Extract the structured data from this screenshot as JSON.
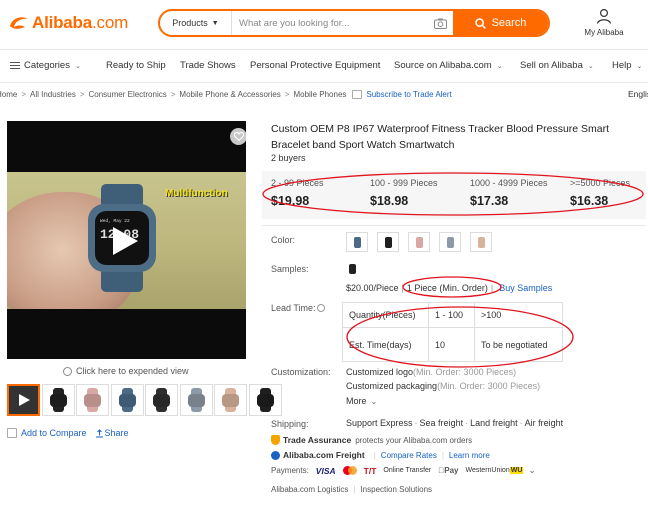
{
  "header": {
    "logo_text": "Alibaba",
    "logo_suffix": ".com",
    "search_category": "Products",
    "search_placeholder": "What are you looking for...",
    "search_button": "Search",
    "account_label": "My Alibaba",
    "accent_color": "#ff6a00"
  },
  "nav": {
    "categories": "Categories",
    "ready_to_ship": "Ready to Ship",
    "trade_shows": "Trade Shows",
    "ppe": "Personal Protective Equipment",
    "source": "Source on Alibaba.com",
    "sell": "Sell on Alibaba",
    "help": "Help"
  },
  "breadcrumb": {
    "items": [
      "Home",
      "All Industries",
      "Consumer Electronics",
      "Mobile Phone & Accessories",
      "Mobile Phones"
    ],
    "alert_link": "Subscribe to Trade Alert",
    "language": "English"
  },
  "gallery": {
    "video_overlay_text": "Multifunction",
    "watch_date": "Wed, May 22",
    "watch_time": "12:08",
    "expand_text": "Click here to expended view",
    "thumb_colors": [
      "#3a3a3a",
      "#222222",
      "#d9a8a4",
      "#4a6a86",
      "#2f2f2f",
      "#8c99a6",
      "#d9b29d",
      "#1f1f1f"
    ],
    "add_to_compare": "Add to Compare",
    "share": "Share"
  },
  "product": {
    "title": "Custom OEM P8 IP67 Waterproof Fitness Tracker Blood Pressure Smart Bracelet band Sport Watch Smartwatch",
    "buyers": "2 buyers",
    "price_tiers": [
      {
        "range": "2 - 99 Pieces",
        "price": "$19.98"
      },
      {
        "range": "100 - 999 Pieces",
        "price": "$18.98"
      },
      {
        "range": "1000 - 4999 Pieces",
        "price": "$17.38"
      },
      {
        "range": ">=5000 Pieces",
        "price": "$16.38"
      }
    ],
    "color_label": "Color:",
    "color_swatches": [
      "#4a6a86",
      "#1f1f1f",
      "#d9a8a4",
      "#8c99a6",
      "#d9b29d"
    ],
    "samples_label": "Samples:",
    "sample_price": "$20.00/Piece",
    "sample_min": "1 Piece (Min. Order)",
    "buy_samples": "Buy Samples",
    "lead_time_label": "Lead Time:",
    "lead_time": {
      "header": [
        "Quantity(Pieces)",
        "1 - 100",
        ">100"
      ],
      "row": [
        "Est. Time(days)",
        "10",
        "To be negotiated"
      ]
    },
    "customization_label": "Customization:",
    "customizations": [
      {
        "name": "Customized logo",
        "min": "(Min. Order: 3000 Pieces)"
      },
      {
        "name": "Customized packaging",
        "min": "(Min. Order: 3000 Pieces)"
      }
    ],
    "more": "More",
    "shipping_label": "Shipping:",
    "shipping_options": [
      "Support Express",
      "Sea freight",
      "Land freight",
      "Air freight"
    ],
    "trade_assurance": "Trade Assurance",
    "trade_assurance_desc": "protects your Alibaba.com orders",
    "freight": "Alibaba.com Freight",
    "compare_rates": "Compare Rates",
    "learn_more": "Learn more",
    "payments_label": "Payments:",
    "payment_brands": [
      "VISA",
      "T/T",
      "Online Transfer",
      "Pay",
      "WesternUnion",
      "WU"
    ],
    "logistics": "Alibaba.com Logistics",
    "inspection": "Inspection Solutions"
  },
  "annotations": {
    "color": "#e0141e"
  }
}
